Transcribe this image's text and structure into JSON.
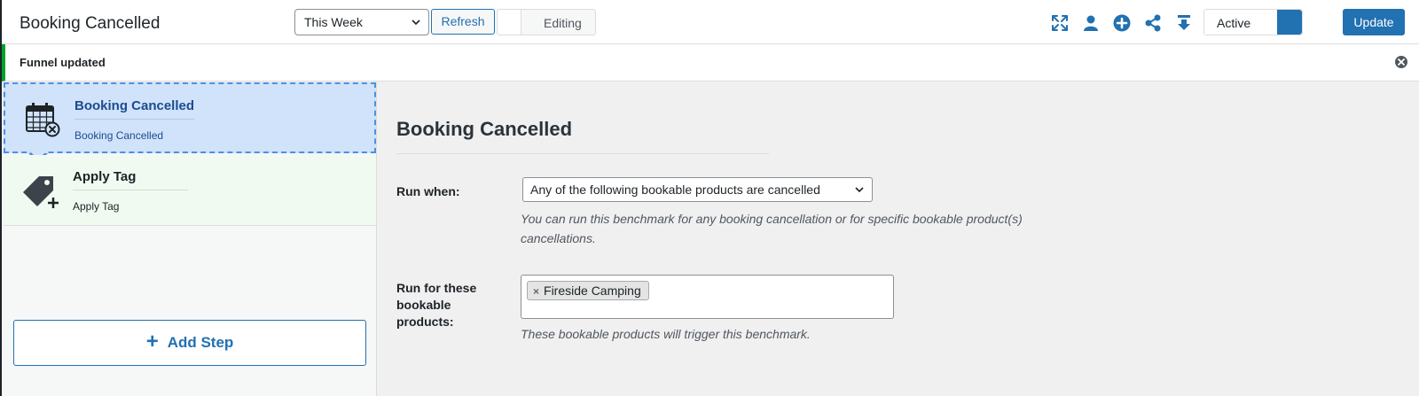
{
  "header": {
    "title": "Booking Cancelled",
    "range_value": "This Week",
    "refresh_label": "Refresh",
    "editing_label": "Editing",
    "status_label": "Active",
    "update_label": "Update"
  },
  "icons": {
    "fullscreen": "fullscreen-icon",
    "contacts": "person-icon",
    "add": "plus-circle-icon",
    "share": "share-icon",
    "export": "download-icon",
    "notice_close": "close-circle-icon"
  },
  "notice": {
    "text": "Funnel updated"
  },
  "steps": [
    {
      "title": "Booking Cancelled",
      "subtitle": "Booking Cancelled",
      "icon": "calendar-cancel-icon",
      "active": true
    },
    {
      "title": "Apply Tag",
      "subtitle": "Apply Tag",
      "icon": "tag-plus-icon",
      "active": false
    }
  ],
  "add_step_label": "Add Step",
  "main": {
    "title": "Booking Cancelled",
    "run_when_label": "Run when:",
    "run_when_value": "Any of the following bookable products are cancelled",
    "run_when_help_1": "You can run this benchmark for any booking cancellation or for specific bookable product(s)",
    "run_when_help_2": "cancellations.",
    "products_label_1": "Run for these",
    "products_label_2": "bookable",
    "products_label_3": "products:",
    "products": [
      "Fireside Camping"
    ],
    "products_help": "These bookable products will trigger this benchmark."
  },
  "colors": {
    "accent": "#2271b1",
    "active_step_bg": "#d0e3fb",
    "active_step_border": "#4a90e2",
    "notice_border": "#00a32a"
  }
}
